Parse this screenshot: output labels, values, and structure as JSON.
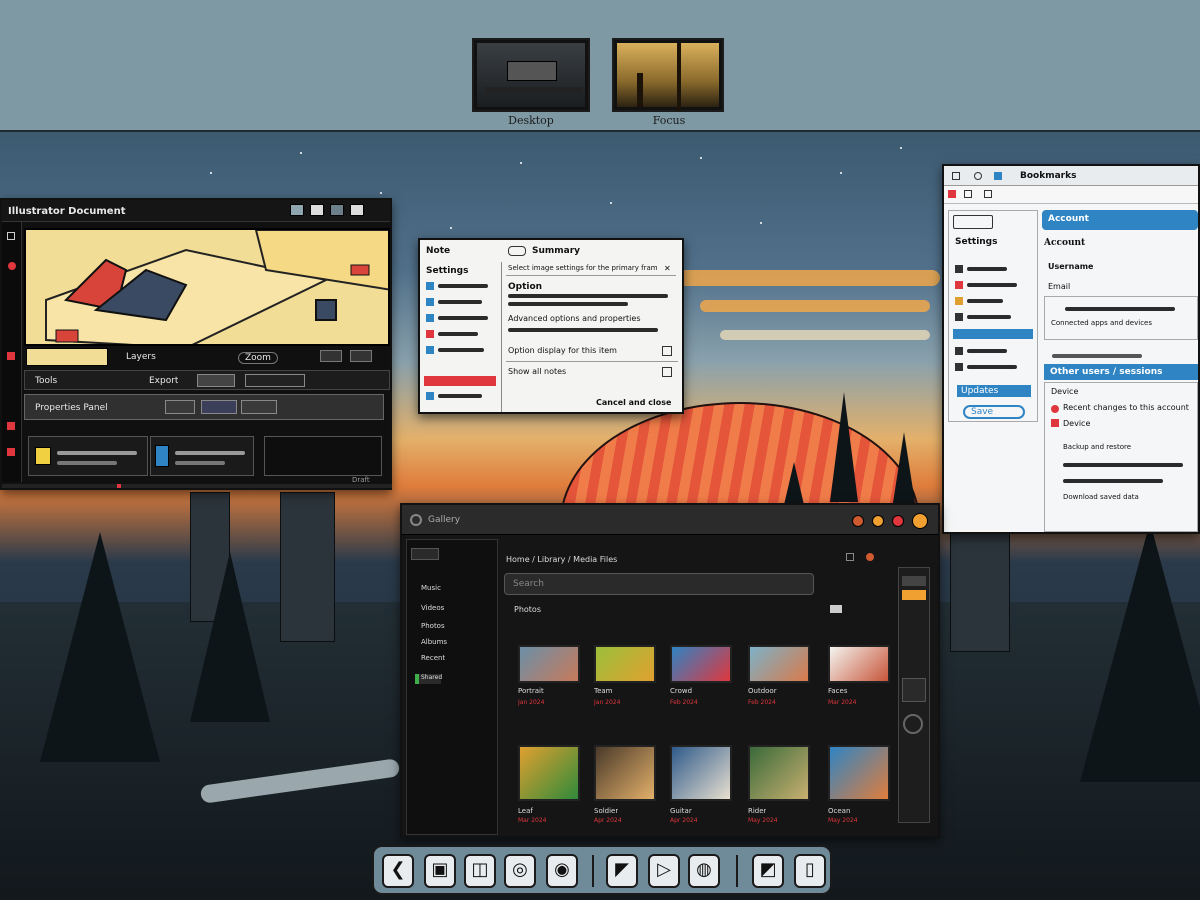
{
  "workspaces": [
    {
      "label": "Desktop"
    },
    {
      "label": "Focus"
    }
  ],
  "windows": {
    "editor": {
      "title": "Illustrator Document",
      "tool_label": "Tools",
      "toolbar_a": "Layers",
      "toolbar_b": "Zoom",
      "toolbar_c": "Export",
      "panel_title": "Properties Panel",
      "status": "Draft"
    },
    "dialog": {
      "title_left": "Note",
      "title_right": "Summary",
      "section_1": "Settings",
      "row_1": "Select image settings for the primary frame",
      "row_2": "Option",
      "row_3": "Advanced options and properties",
      "row_4": "Option display for this item",
      "row_5": "Show all notes",
      "footer": "Cancel and close"
    },
    "browser": {
      "tab": "Bookmarks",
      "header": "Account",
      "nav_title": "Settings",
      "section_a": "Account",
      "row_1": "Username",
      "row_2": "Email",
      "row_3": "Connected apps and devices",
      "banner": "Other users / sessions",
      "row_4": "Device",
      "row_5": "Recent changes to this account",
      "row_6": "Device",
      "row_7": "Backup and restore",
      "row_8": "Download saved data",
      "sidebar_btn": "Updates",
      "sidebar_btn_2": "Save"
    },
    "media": {
      "title": "Gallery",
      "breadcrumb": "Home  /  Library  /  Media Files",
      "search_placeholder": "Search",
      "folder": "Photos",
      "sidebar": [
        "Music",
        "Videos",
        "Photos",
        "Albums",
        "Recent",
        "Shared"
      ],
      "items": [
        {
          "title": "Portrait",
          "sub": "Jan 2024"
        },
        {
          "title": "Team",
          "sub": "Jan 2024"
        },
        {
          "title": "Crowd",
          "sub": "Feb 2024"
        },
        {
          "title": "Outdoor",
          "sub": "Feb 2024"
        },
        {
          "title": "Faces",
          "sub": "Mar 2024"
        },
        {
          "title": "Leaf",
          "sub": "Mar 2024"
        },
        {
          "title": "Soldier",
          "sub": "Apr 2024"
        },
        {
          "title": "Guitar",
          "sub": "Apr 2024"
        },
        {
          "title": "Rider",
          "sub": "May 2024"
        },
        {
          "title": "Ocean",
          "sub": "May 2024"
        }
      ]
    }
  },
  "dock": [
    {
      "icon": "back-icon",
      "glyph": "❮"
    },
    {
      "icon": "files-icon",
      "glyph": "▣"
    },
    {
      "icon": "window-icon",
      "glyph": "◫"
    },
    {
      "icon": "browser-icon",
      "glyph": "◎"
    },
    {
      "icon": "search-icon",
      "glyph": "◉"
    },
    {
      "icon": "notes-icon",
      "glyph": "◤"
    },
    {
      "icon": "play-icon",
      "glyph": "▷"
    },
    {
      "icon": "chat-icon",
      "glyph": "◍"
    },
    {
      "icon": "pen-icon",
      "glyph": "◩"
    },
    {
      "icon": "trash-icon",
      "glyph": "▯"
    }
  ],
  "colors": {
    "accent_red": "#e0363d",
    "accent_blue": "#2f84c4",
    "accent_orange": "#f0a030"
  }
}
